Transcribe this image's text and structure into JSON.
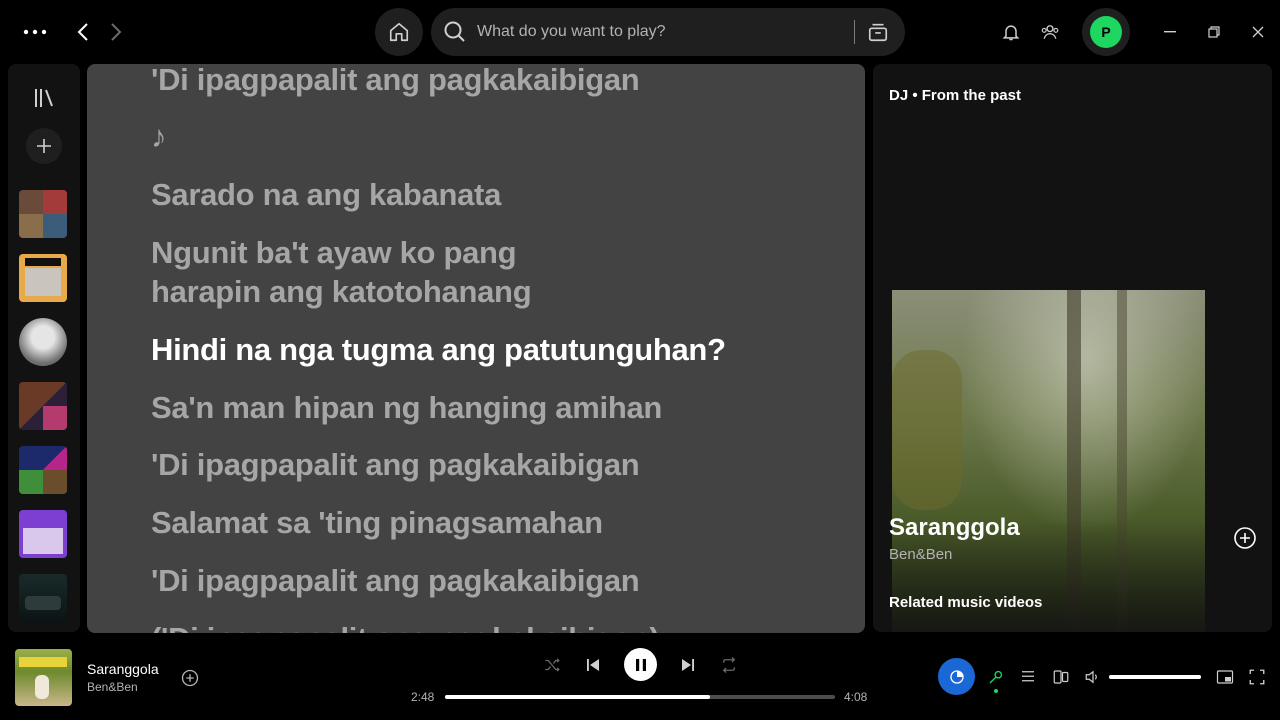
{
  "search": {
    "placeholder": "What do you want to play?"
  },
  "profile": {
    "initial": "P",
    "color": "#1ed760"
  },
  "lyrics": {
    "lines": [
      "'Di ipagpapalit ang pagkakaibigan",
      "♪",
      "Sarado na ang kabanata",
      "Ngunit ba't ayaw ko pang harapin ang katotohanang",
      "Hindi na nga tugma ang patutunguhan?",
      "Sa'n man hipan ng hanging amihan",
      "'Di ipagpapalit ang pagkakaibigan",
      "Salamat sa 'ting pinagsamahan",
      "'Di ipagpapalit ang pagkakaibigan",
      "('Di ipagpapalit ang pagkakaibigan)"
    ],
    "active_index": 4,
    "background": "#434343"
  },
  "right_panel": {
    "title": "DJ • From the past",
    "song": "Saranggola",
    "artist": "Ben&Ben",
    "related_heading": "Related music videos"
  },
  "now_playing": {
    "title": "Saranggola",
    "artist": "Ben&Ben",
    "elapsed": "2:48",
    "duration": "4:08",
    "progress": 0.68,
    "volume": 1.0
  },
  "sidebar": {
    "thumbnails": [
      "playlist-mix",
      "this-is-lany",
      "artist-circle",
      "playlist-dark",
      "true-playlist",
      "hot-hits-philippines",
      "car-playlist"
    ]
  },
  "colors": {
    "accent": "#1ed760",
    "connect": "#1a68d6",
    "lyrics_active": "#ffffff",
    "lyrics_inactive": "#a6a6a6"
  }
}
